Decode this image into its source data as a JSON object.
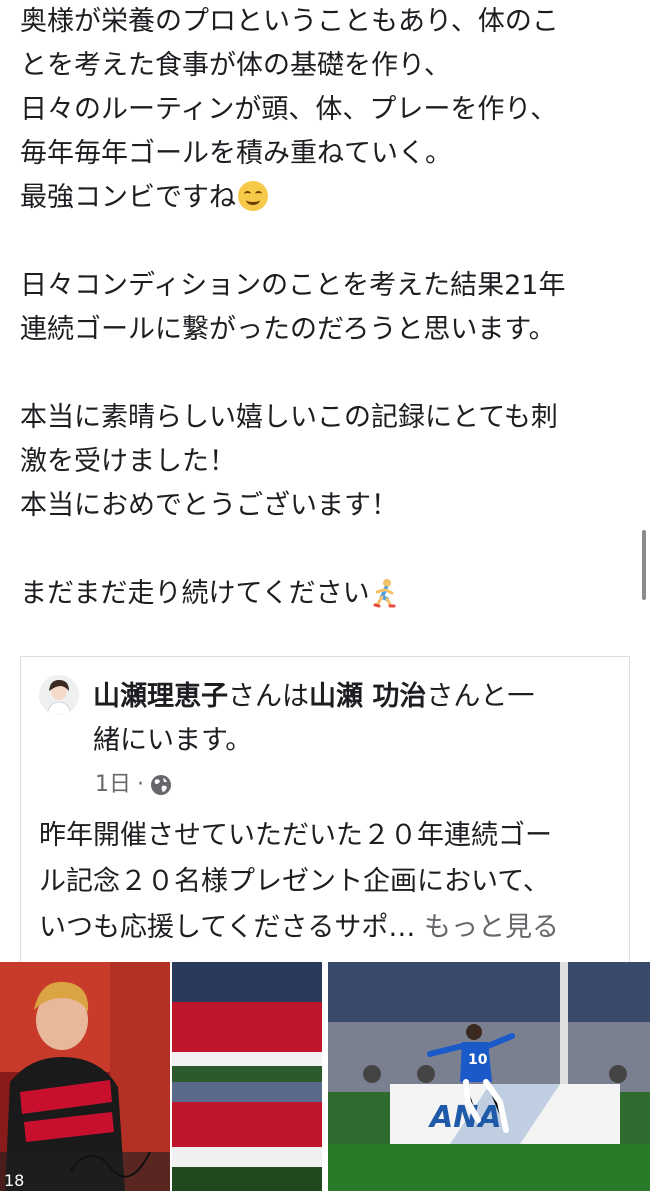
{
  "post": {
    "lines": [
      "奥様が栄養のプロということもあり、体のこ",
      "とを考えた食事が体の基礎を作り、",
      "日々のルーティンが頭、体、プレーを作り、",
      "毎年毎年ゴールを積み重ねていく。",
      "最強コンビですね",
      "",
      "日々コンディションのことを考えた結果21年",
      "連続ゴールに繋がったのだろうと思います。",
      "",
      "本当に素晴らしい嬉しいこの記録にとても刺",
      "激を受けました！",
      "本当におめでとうございます！",
      "",
      "まだまだ走り続けてください"
    ]
  },
  "shared": {
    "author": "山瀬理恵子",
    "with_text_1": "さんは",
    "tagged": "山瀬 功治",
    "with_text_2": "さんと一",
    "with_text_3": "緒にいます。",
    "time": "1日",
    "separator": "·",
    "text_lines": [
      "昨年開催させていただいた２０年連続ゴー",
      "ル記念２０名様プレゼント企画において、",
      "いつも応援してくださるサポ…"
    ],
    "see_more": "もっと見る"
  },
  "icons": [
    "smiling-face-emoji",
    "running-person-emoji",
    "globe-icon"
  ],
  "photos": {
    "jersey_number": "10",
    "banner_text": "ANA",
    "card_number": "18"
  }
}
